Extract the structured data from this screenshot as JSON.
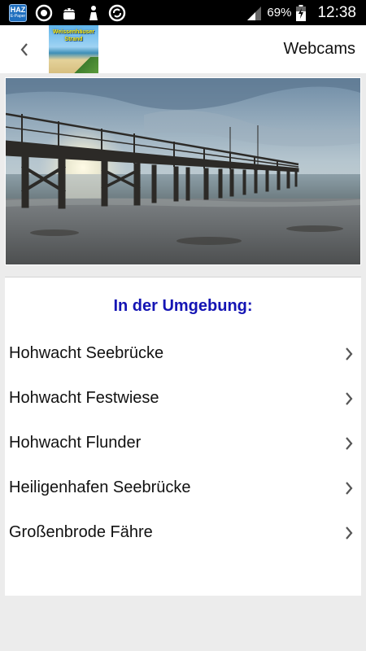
{
  "status_bar": {
    "haz_label": "HAZ",
    "haz_sub": "E-Paper",
    "battery_percent": "69%",
    "time": "12:38",
    "icons": [
      "haz-app-icon",
      "sync-icon",
      "android-icon",
      "usb-debug-icon",
      "refresh-icon",
      "signal-icon",
      "battery-charging-icon"
    ]
  },
  "action_bar": {
    "back_icon": "chevron-left-icon",
    "logo_text_line1": "Weissenhäuser",
    "logo_text_line2": "Strand",
    "title": "Webcams"
  },
  "webcam_image": {
    "subject": "pier-at-sunset"
  },
  "nearby": {
    "heading": "In der Umgebung:",
    "heading_color": "#1414b4",
    "items": [
      {
        "label": "Hohwacht Seebrücke"
      },
      {
        "label": "Hohwacht Festwiese"
      },
      {
        "label": "Hohwacht Flunder"
      },
      {
        "label": "Heiligenhafen Seebrücke"
      },
      {
        "label": "Großenbrode Fähre"
      }
    ]
  }
}
